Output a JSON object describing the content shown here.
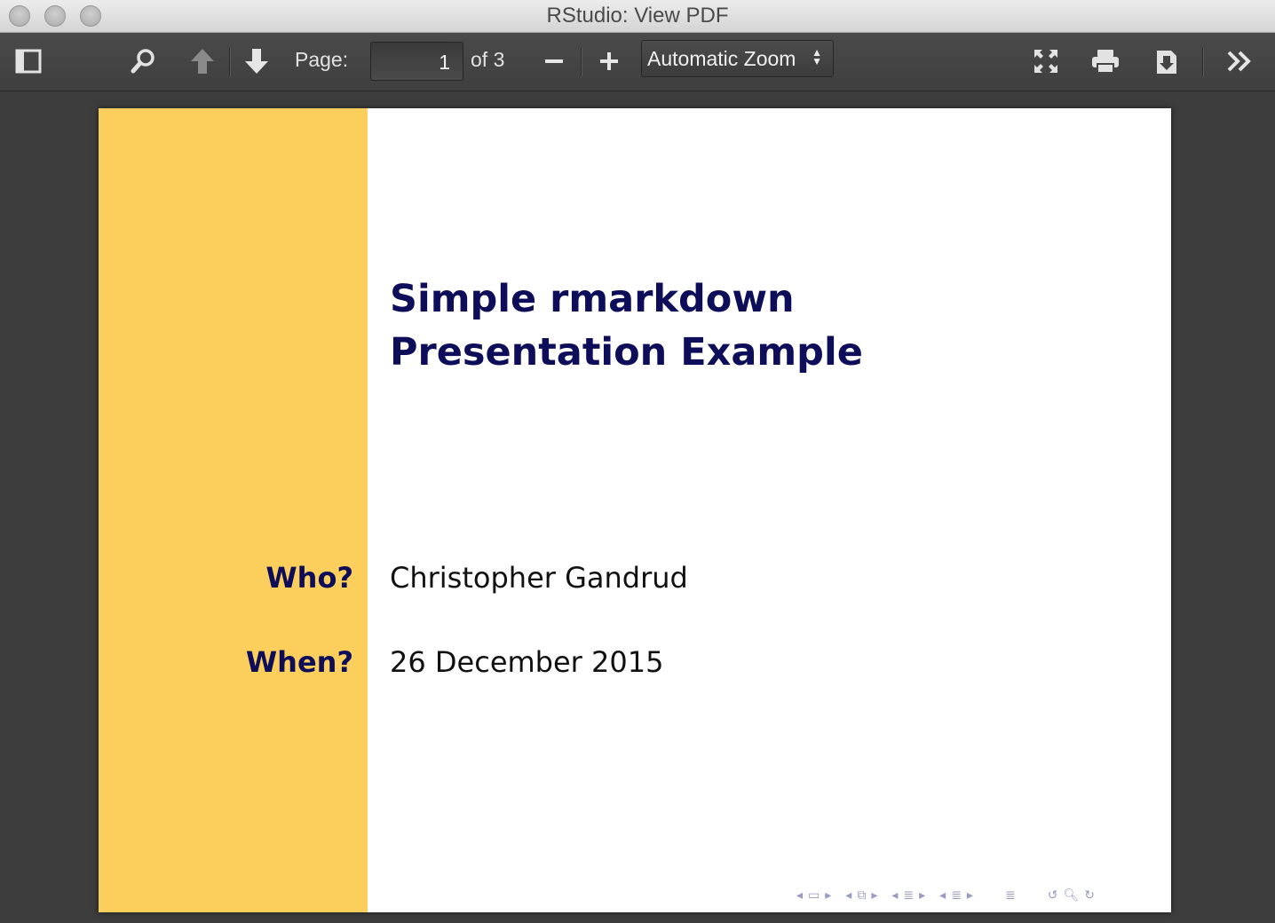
{
  "window": {
    "title": "RStudio: View PDF"
  },
  "toolbar": {
    "page_label": "Page:",
    "page_value": "1",
    "page_total": "of 3",
    "zoom_value": "Automatic Zoom",
    "icons": [
      "sidebar-toggle-icon",
      "search-icon",
      "previous-page-icon",
      "next-page-icon",
      "zoom-out-icon",
      "zoom-in-icon",
      "presentation-mode-icon",
      "print-icon",
      "download-icon",
      "tools-icon"
    ]
  },
  "slide": {
    "sidebar_color": "#fccf5c",
    "title_color": "#0d0d5a",
    "title": "Simple rmarkdown Presentation Example",
    "fields": [
      {
        "label": "Who?",
        "value": "Christopher Gandrud"
      },
      {
        "label": "When?",
        "value": "26 December 2015"
      }
    ]
  }
}
